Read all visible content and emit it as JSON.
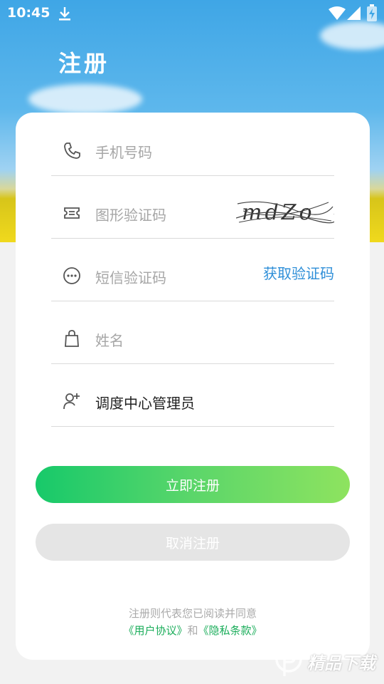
{
  "status_bar": {
    "time": "10:45"
  },
  "header": {
    "title": "注册"
  },
  "form": {
    "phone_placeholder": "手机号码",
    "captcha_placeholder": "图形验证码",
    "captcha_text": "mdZo",
    "sms_placeholder": "短信验证码",
    "sms_button": "获取验证码",
    "name_placeholder": "姓名",
    "role_value": "调度中心管理员"
  },
  "actions": {
    "register_label": "立即注册",
    "cancel_label": "取消注册"
  },
  "agreement": {
    "line1": "注册则代表您已阅读并同意",
    "user_agreement": "《用户协议》",
    "and": "和",
    "privacy_policy": "《隐私条款》"
  },
  "watermark": {
    "text": "精品下载"
  },
  "icons": {
    "phone": "phone-icon",
    "captcha": "ticket-icon",
    "sms": "chat-dots-icon",
    "name": "bag-icon",
    "role": "user-add-icon"
  },
  "colors": {
    "accent_link": "#2f8fd8",
    "primary_gradient_start": "#17c96a",
    "primary_gradient_end": "#8ee35f",
    "agreement_link": "#1aad5a"
  }
}
